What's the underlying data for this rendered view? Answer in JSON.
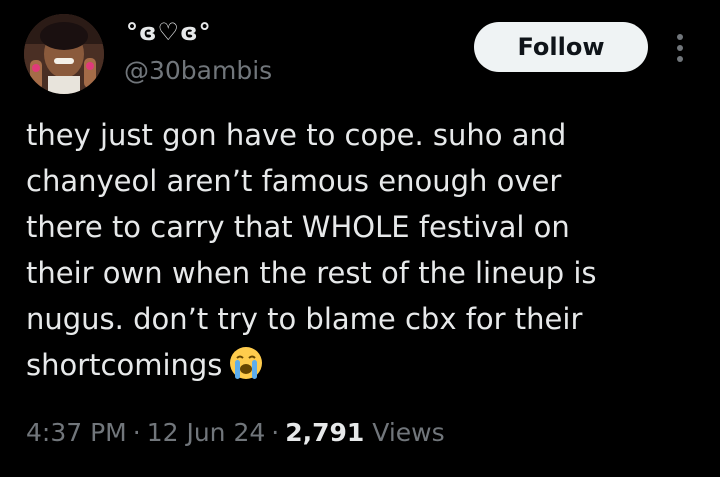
{
  "author": {
    "display_name": "°ɞ♡ɞ°",
    "handle": "@30bambis"
  },
  "follow_label": "Follow",
  "tweet": {
    "lines": [
      "they just gon have to cope. suho and",
      "chanyeol aren’t famous enough over",
      "there to carry that WHOLE festival on",
      "their own when the rest of the lineup is",
      "nugus. don’t try to blame cbx for their",
      "shortcomings"
    ],
    "emoji": "loudly-crying-face"
  },
  "meta": {
    "time": "4:37 PM",
    "separator": "·",
    "date": "12 Jun 24",
    "views_count": "2,791",
    "views_label": "Views"
  },
  "colors": {
    "background": "#000000",
    "text": "#e7e9ea",
    "secondary": "#71767b",
    "button_bg": "#eff3f4"
  }
}
